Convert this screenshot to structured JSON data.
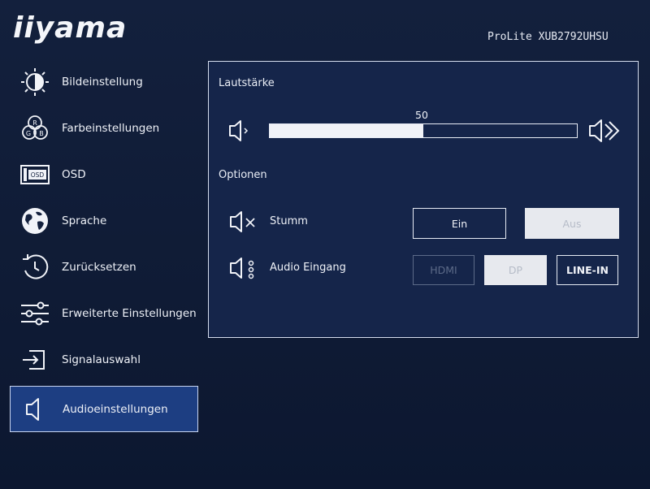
{
  "header": {
    "brand": "iiyama",
    "model": "ProLite XUB2792UHSU"
  },
  "sidebar": {
    "items": [
      {
        "label": "Bildeinstellung",
        "icon": "brightness-icon"
      },
      {
        "label": "Farbeinstellungen",
        "icon": "rgb-icon"
      },
      {
        "label": "OSD",
        "icon": "osd-icon",
        "icon_text": "OSD"
      },
      {
        "label": "Sprache",
        "icon": "globe-icon"
      },
      {
        "label": "Zurücksetzen",
        "icon": "reset-icon"
      },
      {
        "label": "Erweiterte Einstellungen",
        "icon": "sliders-icon"
      },
      {
        "label": "Signalauswahl",
        "icon": "input-icon"
      },
      {
        "label": "Audioeinstellungen",
        "icon": "speaker-icon",
        "active": true
      }
    ],
    "rgb_letters": [
      "R",
      "G",
      "B"
    ]
  },
  "panel": {
    "volume_heading": "Lautstärke",
    "volume_value": "50",
    "volume_fraction": 0.5,
    "options_heading": "Optionen",
    "mute": {
      "label": "Stumm",
      "on_label": "Ein",
      "off_label": "Aus",
      "selected": "Aus"
    },
    "audio_input": {
      "label": "Audio Eingang",
      "options": [
        "HDMI",
        "DP",
        "LINE-IN"
      ],
      "selected": "DP",
      "disabled": "HDMI"
    }
  },
  "colors": {
    "background": "#0f1a33",
    "active_item": "#1d3e82",
    "text": "#eef1f7"
  }
}
